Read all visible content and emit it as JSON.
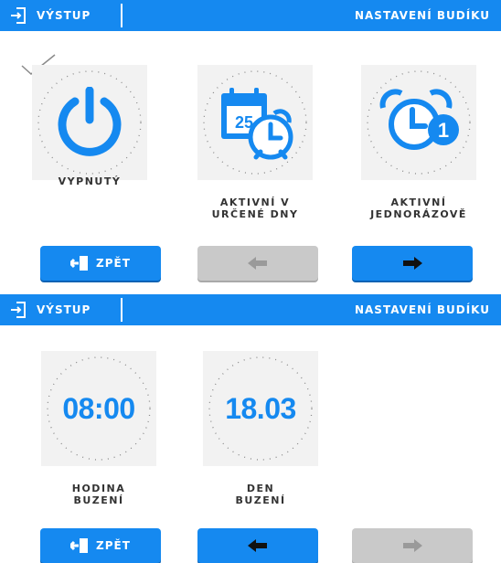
{
  "screen1": {
    "header": {
      "exit_label": "VÝSTUP",
      "title": "NASTAVENÍ BUDÍKU"
    },
    "options": [
      {
        "icon": "power-icon",
        "label_lines": [
          "VYPNUTÝ"
        ],
        "selected": true
      },
      {
        "icon": "calendar-clock-icon",
        "calendar_day": "25",
        "label_lines": [
          "AKTIVNÍ V",
          "URČENÉ DNY"
        ]
      },
      {
        "icon": "alarm-clock-one-icon",
        "badge": "1",
        "label_lines": [
          "AKTIVNÍ",
          "JEDNORÁZOVĚ"
        ]
      }
    ],
    "buttons": {
      "back_label": "ZPĚT",
      "prev_enabled": false,
      "next_enabled": true
    }
  },
  "screen2": {
    "header": {
      "exit_label": "VÝSTUP",
      "title": "NASTAVENÍ BUDÍKU"
    },
    "fields": [
      {
        "value": "08:00",
        "label_lines": [
          "HODINA",
          "BUZENÍ"
        ]
      },
      {
        "value": "18.03",
        "label_lines": [
          "DEN",
          "BUZENÍ"
        ]
      }
    ],
    "buttons": {
      "back_label": "ZPĚT",
      "prev_enabled": true,
      "next_enabled": false
    }
  },
  "colors": {
    "accent": "#1589f0",
    "disabled": "#c9c9c9",
    "tile_bg": "#f2f2f2",
    "label_text": "#333333"
  }
}
